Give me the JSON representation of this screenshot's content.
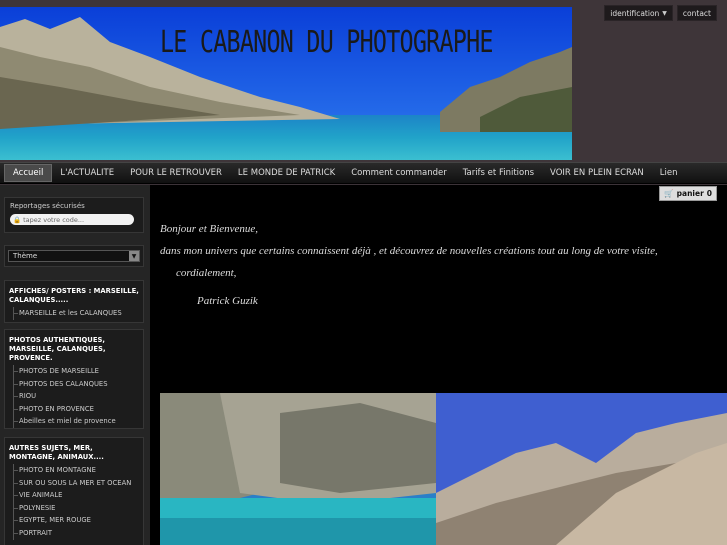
{
  "site": {
    "title": "LE CABANON DU PHOTOGRAPHE"
  },
  "toplinks": {
    "identification": "identification",
    "contact": "contact"
  },
  "nav": [
    "Accueil",
    "L'ACTUALITE",
    "POUR LE RETROUVER",
    "LE MONDE DE PATRICK",
    "Comment commander",
    "Tarifs et Finitions",
    "VOIR EN PLEIN ECRAN",
    "Lien"
  ],
  "sidebar": {
    "secure": {
      "label": "Reportages sécurisés",
      "placeholder": "tapez votre code..."
    },
    "theme": {
      "label": "Thème"
    },
    "categories": [
      {
        "title": "AFFICHES/ POSTERS : MARSEILLE, CALANQUES.....",
        "items": [
          "MARSEILLE et les CALANQUES"
        ]
      },
      {
        "title": "PHOTOS AUTHENTIQUES, MARSEILLE, CALANQUES, PROVENCE.",
        "items": [
          "PHOTOS DE MARSEILLE",
          "PHOTOS DES CALANQUES",
          "RIOU",
          "PHOTO EN PROVENCE",
          "Abeilles et miel de provence"
        ]
      },
      {
        "title": "AUTRES SUJETS, MER, MONTAGNE, ANIMAUX....",
        "items": [
          "PHOTO EN MONTAGNE",
          "SUR OU SOUS LA MER ET OCEAN",
          "VIE ANIMALE",
          "POLYNESIE",
          "EGYPTE, MER ROUGE",
          "PORTRAIT"
        ]
      }
    ]
  },
  "cart": {
    "label": "panier",
    "count": "0"
  },
  "welcome": {
    "line1": "Bonjour et Bienvenue,",
    "line2": "dans mon univers que certains connaissent déjà , et découvrez de nouvelles créations tout au long de votre visite,",
    "line3": "cordialement,",
    "signature": "Patrick Guzik"
  },
  "colors": {
    "background": "#3c3338",
    "nav": "#101010",
    "main": "#000000"
  }
}
